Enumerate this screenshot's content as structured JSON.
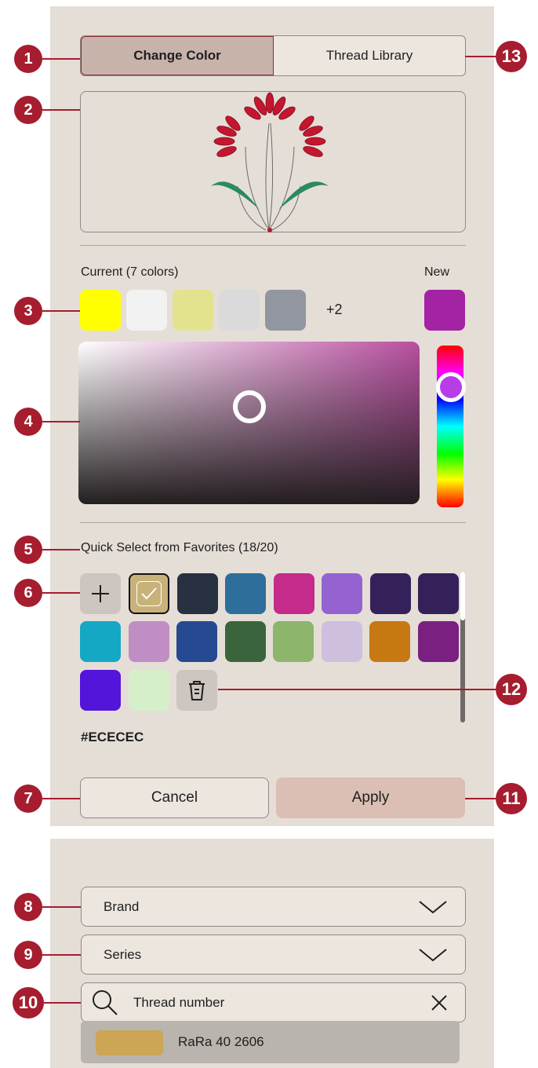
{
  "tabs": {
    "change_color": "Change Color",
    "thread_library": "Thread Library"
  },
  "current": {
    "label": "Current (7 colors)",
    "more": "+2",
    "new_label": "New",
    "swatches": [
      "#ffff00",
      "#f2f2f2",
      "#e3e38f",
      "#dadada",
      "#9296a1"
    ],
    "new_color": "#a323a4"
  },
  "picker": {
    "selected_color": "#b84fa0",
    "hue_color": "#b73ee6"
  },
  "favorites": {
    "label": "Quick Select from Favorites (18/20)",
    "hex_readout": "#ECECEC",
    "row1": [
      "#c9b27a",
      "#283142",
      "#2e6e9a",
      "#c42b8b",
      "#9463d1",
      "#35215a",
      "#35215a"
    ],
    "row2": [
      "#14a8c4",
      "#c08dc4",
      "#254a91",
      "#3a653c",
      "#8db56c",
      "#cfbfdf",
      "#c67813",
      "#7a2081"
    ],
    "row3": [
      "#5215d9",
      "#d6efcb"
    ],
    "add_icon": "plus-icon",
    "delete_icon": "trash-icon",
    "selected_icon": "checkmark-icon"
  },
  "buttons": {
    "cancel": "Cancel",
    "apply": "Apply"
  },
  "library": {
    "brand_label": "Brand",
    "series_label": "Series",
    "search_placeholder": "Thread number",
    "result_text": "RaRa 40  2606",
    "result_color": "#cca655"
  },
  "callouts": [
    "1",
    "2",
    "3",
    "4",
    "5",
    "6",
    "7",
    "8",
    "9",
    "10",
    "11",
    "12",
    "13"
  ]
}
